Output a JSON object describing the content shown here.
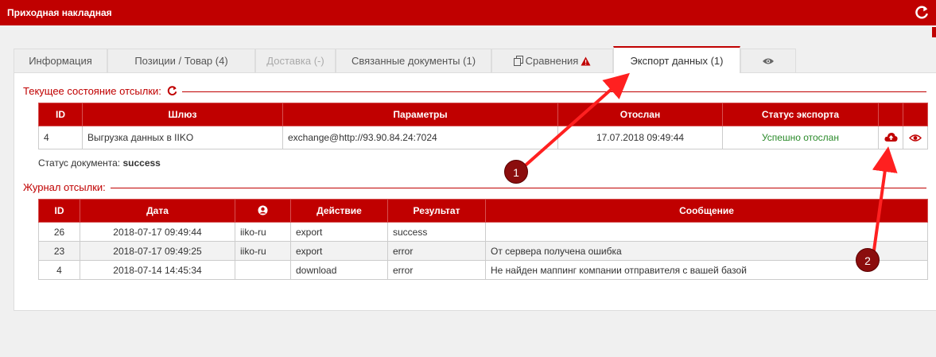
{
  "window": {
    "title": "Приходная накладная"
  },
  "tabs": [
    {
      "label": "Информация"
    },
    {
      "label": "Позиции / Товар (4)"
    },
    {
      "label": "Доставка (-)"
    },
    {
      "label": "Связанные документы (1)"
    },
    {
      "label": "Сравнения"
    },
    {
      "label": "Экспорт данных (1)"
    }
  ],
  "export_state": {
    "title": "Текущее состояние отсылки:",
    "headers": [
      "ID",
      "Шлюз",
      "Параметры",
      "Отослан",
      "Статус экспорта"
    ],
    "row": {
      "id": "4",
      "gateway": "Выгрузка данных в IIKO",
      "params": "exchange@http://93.90.84.24:7024",
      "sent": "17.07.2018 09:49:44",
      "status": "Успешно отослан"
    },
    "status_color": "#2a8a2a"
  },
  "document_status": {
    "label": "Статус документа:",
    "value": "success"
  },
  "journal": {
    "title": "Журнал отсылки:",
    "headers": [
      "ID",
      "Дата",
      "Действие",
      "Результат",
      "Сообщение"
    ],
    "rows": [
      {
        "id": "26",
        "date": "2018-07-17 09:49:44",
        "user": "iiko-ru",
        "action": "export",
        "result": "success",
        "message": ""
      },
      {
        "id": "23",
        "date": "2018-07-17 09:49:25",
        "user": "iiko-ru",
        "action": "export",
        "result": "error",
        "message": "От сервера получена ошибка"
      },
      {
        "id": "4",
        "date": "2018-07-14 14:45:34",
        "user": "",
        "action": "download",
        "result": "error",
        "message": "Не найден маппинг компании отправителя с вашей базой"
      }
    ]
  },
  "annotations": {
    "badge1": "1",
    "badge2": "2"
  },
  "colors": {
    "accent": "#c00000",
    "badge": "#8b0d0d",
    "arrow": "#ff0000"
  }
}
